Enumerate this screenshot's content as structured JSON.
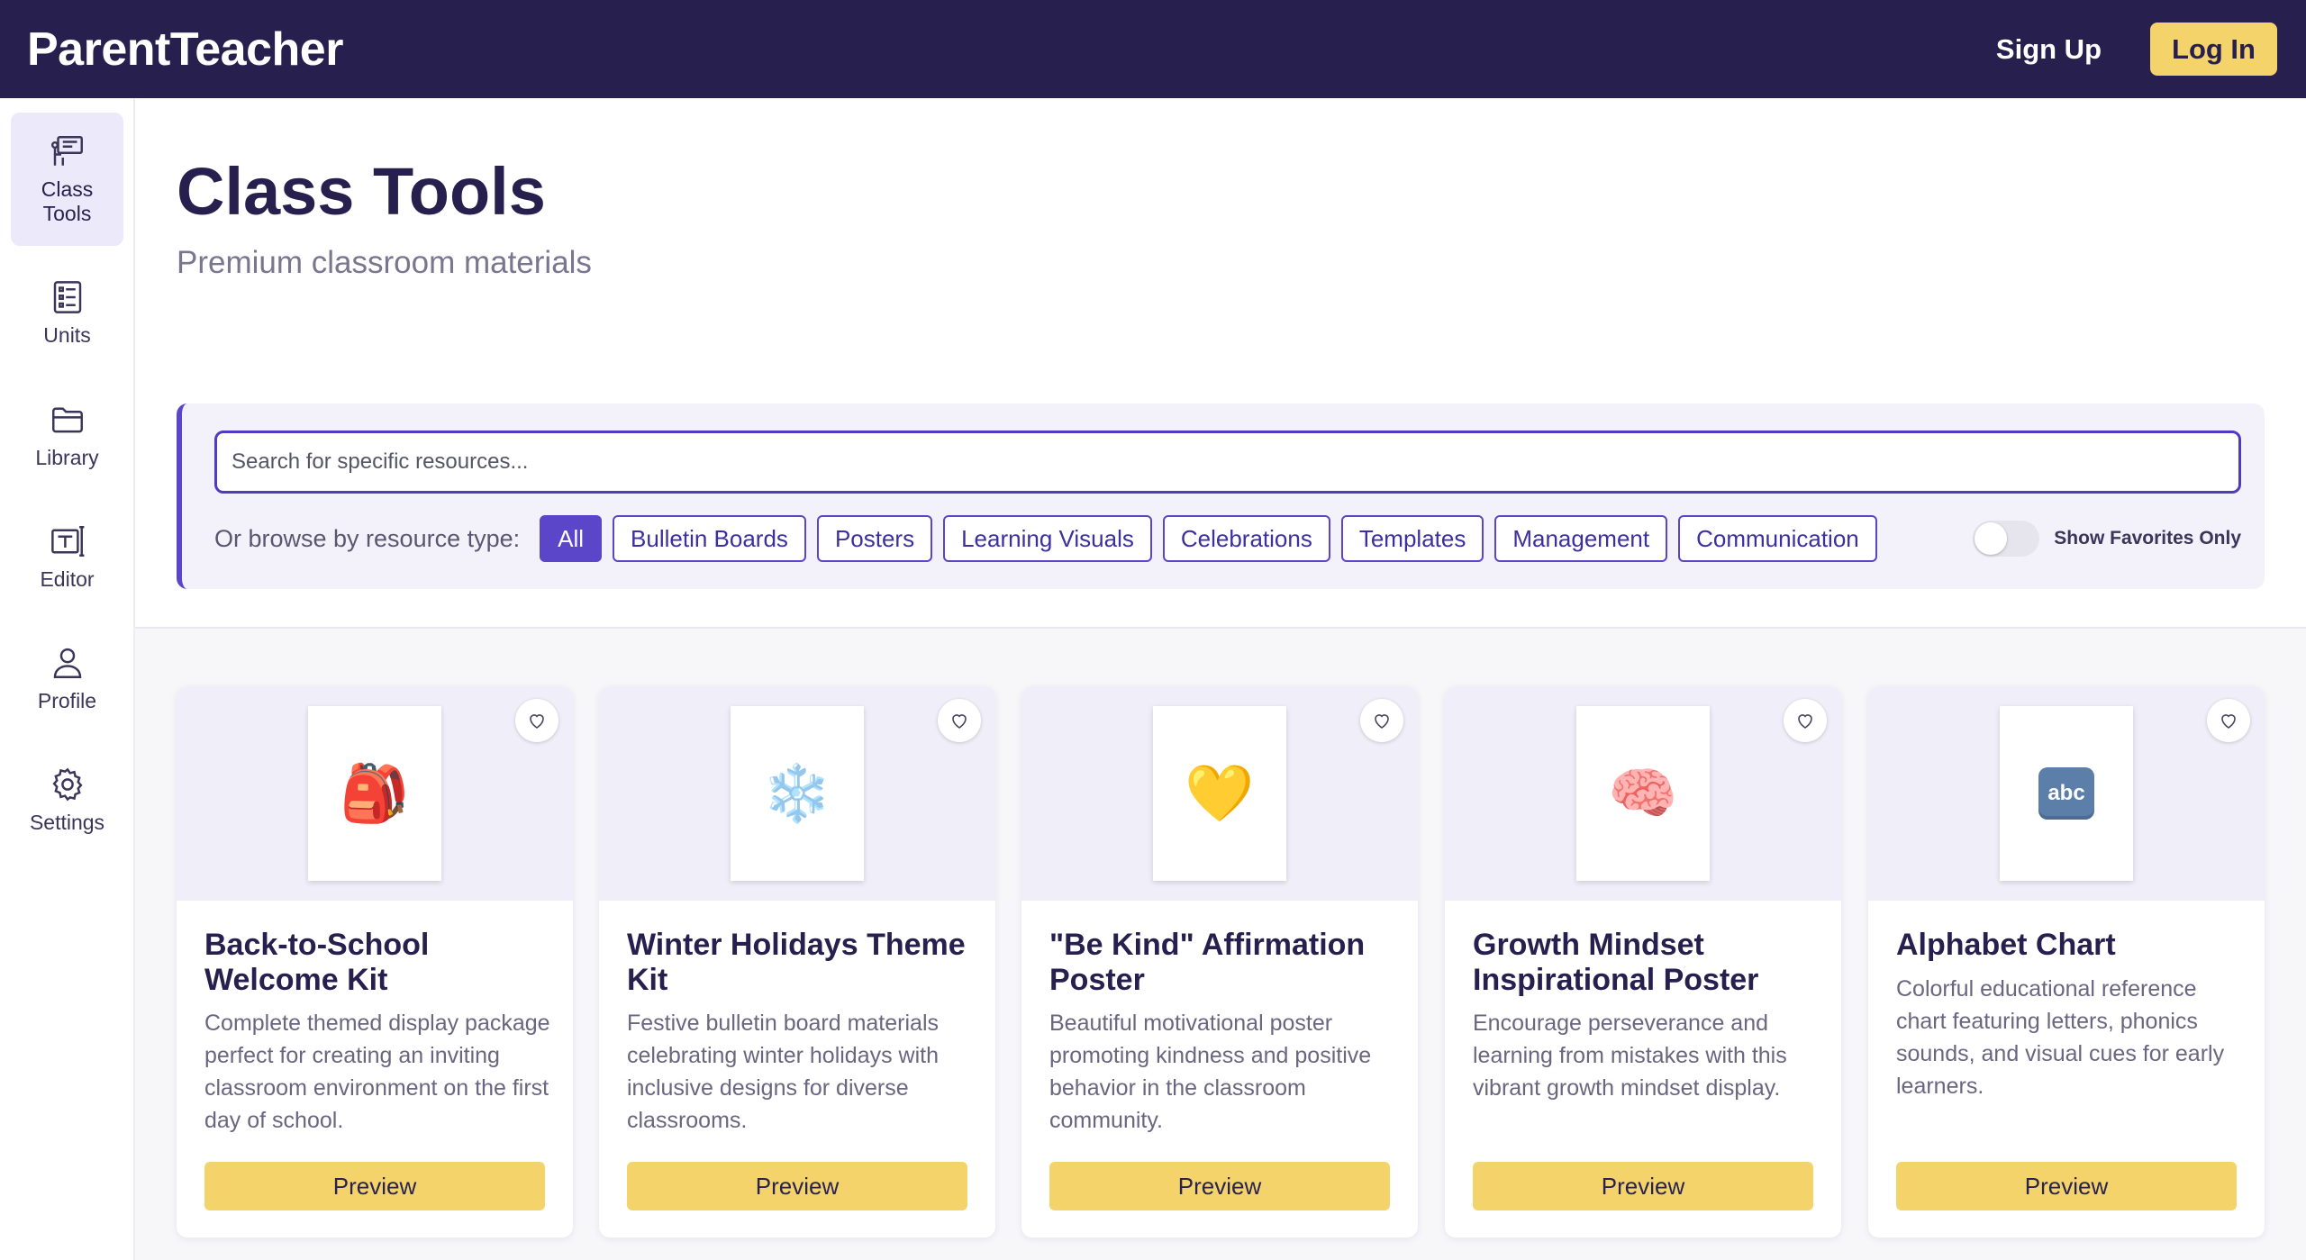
{
  "app": {
    "logo": "ParentTeacher",
    "signup_label": "Sign Up",
    "login_label": "Log In"
  },
  "sidebar": {
    "items": [
      {
        "label": "Class\nTools",
        "icon": "presentation-board-icon",
        "active": true
      },
      {
        "label": "Units",
        "icon": "list-icon"
      },
      {
        "label": "Library",
        "icon": "folder-icon"
      },
      {
        "label": "Editor",
        "icon": "text-editor-icon"
      },
      {
        "label": "Profile",
        "icon": "person-icon"
      },
      {
        "label": "Settings",
        "icon": "gear-icon"
      }
    ]
  },
  "page": {
    "title": "Class Tools",
    "subtitle": "Premium classroom materials"
  },
  "filters": {
    "search_placeholder": "Search for specific resources...",
    "browse_label": "Or browse by resource type:",
    "chips": [
      "All",
      "Bulletin Boards",
      "Posters",
      "Learning Visuals",
      "Celebrations",
      "Templates",
      "Management",
      "Communication"
    ],
    "active_chip": "All",
    "favorites_label": "Show Favorites Only",
    "favorites_only": false
  },
  "cards": [
    {
      "title": "Back-to-School Welcome Kit",
      "description": "Complete themed display package perfect for creating an inviting classroom environment on the first day of school.",
      "thumb": "🎒",
      "preview_label": "Preview"
    },
    {
      "title": "Winter Holidays Theme Kit",
      "description": "Festive bulletin board materials celebrating winter holidays with inclusive designs for diverse classrooms.",
      "thumb": "❄️",
      "preview_label": "Preview"
    },
    {
      "title": "\"Be Kind\" Affirmation Poster",
      "description": "Beautiful motivational poster promoting kindness and positive behavior in the classroom community.",
      "thumb": "💛",
      "preview_label": "Preview"
    },
    {
      "title": "Growth Mindset Inspirational Poster",
      "description": "Encourage perseverance and learning from mistakes with this vibrant growth mindset display.",
      "thumb": "🧠",
      "preview_label": "Preview"
    },
    {
      "title": "Alphabet Chart",
      "description": "Colorful educational reference chart featuring letters, phonics sounds, and visual cues for early learners.",
      "thumb": "abc",
      "preview_label": "Preview"
    }
  ],
  "colors": {
    "header_bg": "#271f4d",
    "accent": "#5b45c9",
    "button_yellow": "#f4d36b"
  }
}
